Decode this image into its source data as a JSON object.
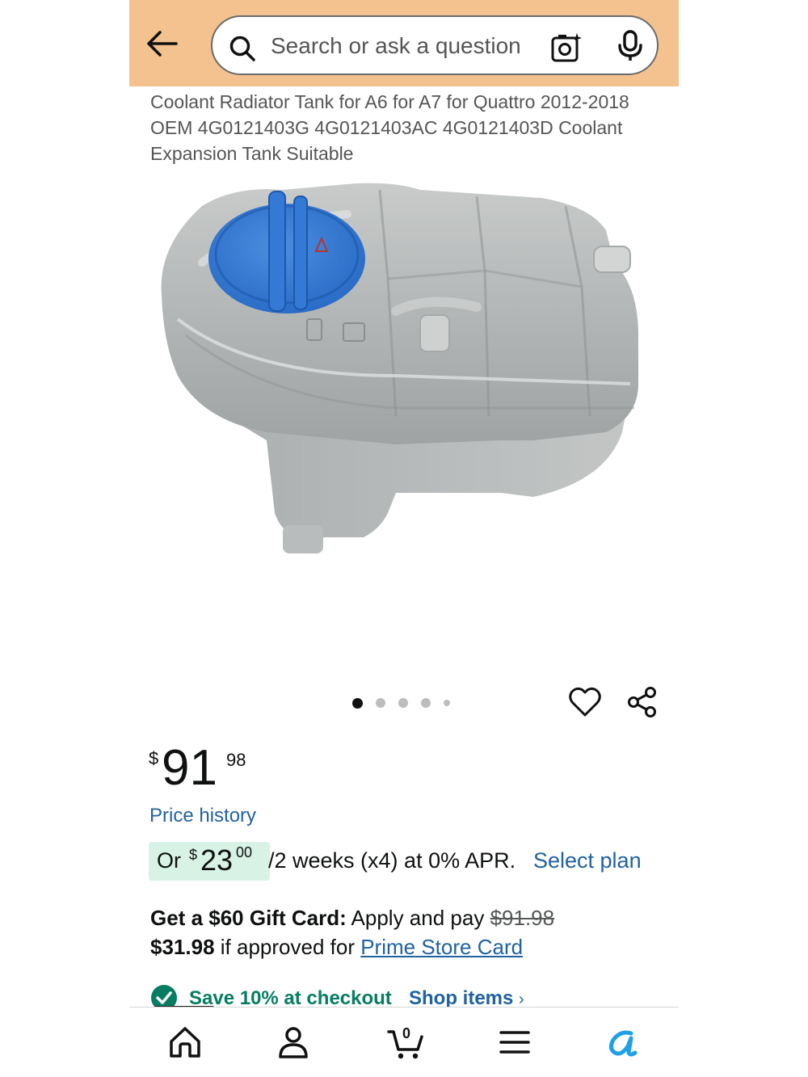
{
  "header": {
    "search_placeholder": "Search or ask a question",
    "background_color": "#f3c28e"
  },
  "product": {
    "title": "Coolant Radiator Tank for A6 for A7 for Quattro 2012-2018 OEM 4G0121403G 4G0121403AC 4G0121403D Coolant Expansion Tank Suitable",
    "image_description_icon": "coolant-expansion-tank-image",
    "carousel": {
      "count": 5,
      "active_index": 0
    }
  },
  "price": {
    "symbol": "$",
    "whole": "91",
    "fraction": "98",
    "history_link": "Price history"
  },
  "installment": {
    "prefix": "Or",
    "symbol": "$",
    "amount": "23",
    "cents": "00",
    "terms": "/2 weeks (x4) at 0% APR.",
    "select_plan": "Select plan"
  },
  "gift_card": {
    "bold": "Get a $60 Gift Card:",
    "text": "Apply and pay",
    "old_price": "$91.98",
    "new_price": "$31.98",
    "suffix": "if approved for",
    "link": "Prime Store Card"
  },
  "promo": {
    "save_text": "Save 10% at checkout",
    "shop_items": "Shop items",
    "chevron": "›"
  },
  "bottom_nav": {
    "items": [
      "home-icon",
      "account-icon",
      "cart-icon",
      "menu-icon",
      "alexa-icon"
    ],
    "cart_count": "0"
  },
  "colors": {
    "link": "#2162a1",
    "promo_green": "#067d62",
    "installment_highlight": "#d8f2e6",
    "alexa_blue": "#1ea0e6"
  }
}
